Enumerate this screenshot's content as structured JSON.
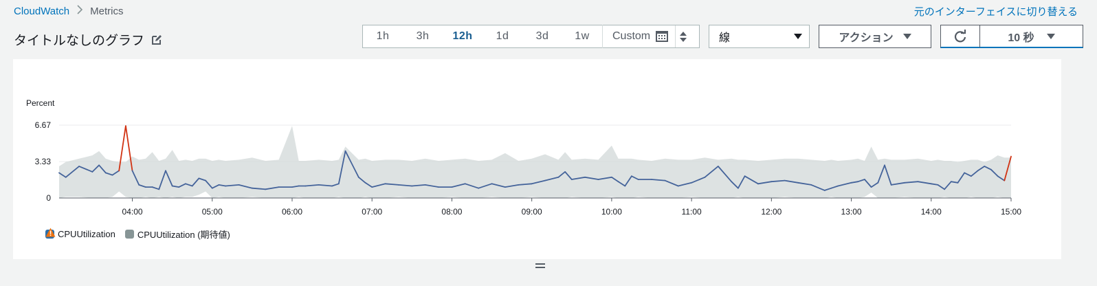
{
  "breadcrumb": {
    "root": "CloudWatch",
    "current": "Metrics"
  },
  "switch_interface": "元のインターフェイスに切り替える",
  "graph_title": "タイトルなしのグラフ",
  "time_ranges": [
    {
      "label": "1h",
      "active": false
    },
    {
      "label": "3h",
      "active": false
    },
    {
      "label": "12h",
      "active": true
    },
    {
      "label": "1d",
      "active": false
    },
    {
      "label": "3d",
      "active": false
    },
    {
      "label": "1w",
      "active": false
    }
  ],
  "custom_label": "Custom",
  "chart_type": "線",
  "actions_label": "アクション",
  "refresh_interval": "10 秒",
  "colors": {
    "link": "#0073bb",
    "series": "#44639a",
    "alarm": "#d13212",
    "band": "#d5dbdb",
    "warning": "#ec7211"
  },
  "icons": {
    "edit": "edit-icon",
    "calendar": "calendar-icon",
    "refresh": "refresh-icon",
    "warning": "warning-icon"
  },
  "chart_data": {
    "type": "line",
    "ylabel": "Percent",
    "y_ticks": [
      "6.67",
      "3.33",
      "0"
    ],
    "ylim": [
      0,
      6.67
    ],
    "x_ticks": [
      "04:00",
      "05:00",
      "06:00",
      "07:00",
      "08:00",
      "09:00",
      "10:00",
      "11:00",
      "12:00",
      "13:00",
      "14:00",
      "15:00"
    ],
    "x_start": "03:05",
    "x_end": "15:00",
    "grid": true,
    "series": [
      {
        "name": "CPUUtilization",
        "color": "#44639a",
        "x": [
          "03:05",
          "03:10",
          "03:20",
          "03:30",
          "03:35",
          "03:40",
          "03:45",
          "03:50",
          "03:55",
          "04:00",
          "04:05",
          "04:10",
          "04:15",
          "04:20",
          "04:25",
          "04:30",
          "04:35",
          "04:40",
          "04:45",
          "04:50",
          "04:55",
          "05:00",
          "05:05",
          "05:10",
          "05:20",
          "05:30",
          "05:40",
          "05:50",
          "06:00",
          "06:05",
          "06:10",
          "06:20",
          "06:30",
          "06:35",
          "06:40",
          "06:50",
          "06:55",
          "07:00",
          "07:10",
          "07:20",
          "07:30",
          "07:40",
          "07:50",
          "08:00",
          "08:10",
          "08:20",
          "08:30",
          "08:40",
          "08:50",
          "09:00",
          "09:10",
          "09:20",
          "09:25",
          "09:30",
          "09:40",
          "09:50",
          "10:00",
          "10:05",
          "10:10",
          "10:15",
          "10:20",
          "10:30",
          "10:40",
          "10:50",
          "11:00",
          "11:10",
          "11:20",
          "11:30",
          "11:35",
          "11:40",
          "11:50",
          "12:00",
          "12:10",
          "12:20",
          "12:30",
          "12:40",
          "12:45",
          "12:50",
          "13:00",
          "13:05",
          "13:10",
          "13:15",
          "13:20",
          "13:25",
          "13:30",
          "13:40",
          "13:50",
          "14:00",
          "14:05",
          "14:10",
          "14:15",
          "14:20",
          "14:25",
          "14:30",
          "14:35",
          "14:40",
          "14:45",
          "14:50",
          "14:55",
          "15:00"
        ],
        "y": [
          2.3,
          1.9,
          2.9,
          2.4,
          3.0,
          2.3,
          2.1,
          2.5,
          6.6,
          2.5,
          1.2,
          1.0,
          1.0,
          0.8,
          2.5,
          1.1,
          1.0,
          1.3,
          1.1,
          1.8,
          1.6,
          0.9,
          1.2,
          1.1,
          1.2,
          0.9,
          0.8,
          1.0,
          1.0,
          1.1,
          1.1,
          1.2,
          1.1,
          1.3,
          4.3,
          1.9,
          1.4,
          1.0,
          1.3,
          1.2,
          1.1,
          1.2,
          1.0,
          1.0,
          1.3,
          0.9,
          1.3,
          1.0,
          1.2,
          1.3,
          1.6,
          1.9,
          2.4,
          1.7,
          1.9,
          1.7,
          1.9,
          1.5,
          1.1,
          2.0,
          1.7,
          1.7,
          1.6,
          1.1,
          1.4,
          1.9,
          2.9,
          1.5,
          0.9,
          2.0,
          1.3,
          1.5,
          1.6,
          1.4,
          1.2,
          0.7,
          0.9,
          1.1,
          1.4,
          1.5,
          1.7,
          1.0,
          1.4,
          3.0,
          1.2,
          1.4,
          1.5,
          1.3,
          1.2,
          0.8,
          1.5,
          1.4,
          2.3,
          2.0,
          2.5,
          2.9,
          2.6,
          2.0,
          1.6,
          3.8
        ]
      },
      {
        "name": "CPUUtilization (期待値)",
        "color": "#d5dbdb",
        "band_upper": [
          2.9,
          3.3,
          3.6,
          3.9,
          4.3,
          3.6,
          3.4,
          3.3,
          3.3,
          3.8,
          3.5,
          3.6,
          4.2,
          3.4,
          3.6,
          4.4,
          3.4,
          3.5,
          3.4,
          3.6,
          3.6,
          3.4,
          3.5,
          3.4,
          3.5,
          3.7,
          3.4,
          3.5,
          6.6,
          3.4,
          3.4,
          3.5,
          3.4,
          3.5,
          4.7,
          3.5,
          3.6,
          3.4,
          3.5,
          3.5,
          3.4,
          3.6,
          3.4,
          3.5,
          3.6,
          3.4,
          3.5,
          4.1,
          3.4,
          3.6,
          4.0,
          3.5,
          4.2,
          3.5,
          3.6,
          3.5,
          4.8,
          3.6,
          3.6,
          3.6,
          3.5,
          3.4,
          3.6,
          3.5,
          3.5,
          3.7,
          3.5,
          3.6,
          3.5,
          3.5,
          3.4,
          3.5,
          3.6,
          3.6,
          3.5,
          3.4,
          3.5,
          3.4,
          3.5,
          3.6,
          3.4,
          4.7,
          3.5,
          3.6,
          3.5,
          3.5,
          3.6,
          3.4,
          3.5,
          3.4,
          3.4,
          3.3,
          3.4,
          3.5,
          3.5,
          3.3,
          3.5,
          3.9,
          3.7,
          3.7
        ],
        "band_lower": [
          0.0,
          0.1,
          0.1,
          0.0,
          0.0,
          0.0,
          0.1,
          0.6,
          0.1,
          0.0,
          0.0,
          0.1,
          0.0,
          0.1,
          0.0,
          0.1,
          0.0,
          0.1,
          0.1,
          0.3,
          0.6,
          0.0,
          0.1,
          0.0,
          0.0,
          0.1,
          0.0,
          0.0,
          0.0,
          0.1,
          0.0,
          0.0,
          0.0,
          0.1,
          0.0,
          0.0,
          0.1,
          0.0,
          0.0,
          0.1,
          0.0,
          0.0,
          0.0,
          0.1,
          0.0,
          0.0,
          0.1,
          0.0,
          0.0,
          0.1,
          0.0,
          0.0,
          0.0,
          0.1,
          0.0,
          0.0,
          0.1,
          0.0,
          0.0,
          0.0,
          0.1,
          0.0,
          0.0,
          0.0,
          0.1,
          0.0,
          0.0,
          0.0,
          0.1,
          0.0,
          0.0,
          0.0,
          0.1,
          0.0,
          0.0,
          0.0,
          0.1,
          0.0,
          0.0,
          0.0,
          0.1,
          0.5,
          0.0,
          0.0,
          0.0,
          0.1,
          0.0,
          0.0,
          0.0,
          0.1,
          0.0,
          0.0,
          0.0,
          0.1,
          0.0,
          0.0,
          0.0,
          0.1,
          0.0,
          0.0
        ]
      }
    ],
    "legend": [
      "CPUUtilization",
      "CPUUtilization (期待値)"
    ],
    "legend_placement": "bottom-left"
  }
}
